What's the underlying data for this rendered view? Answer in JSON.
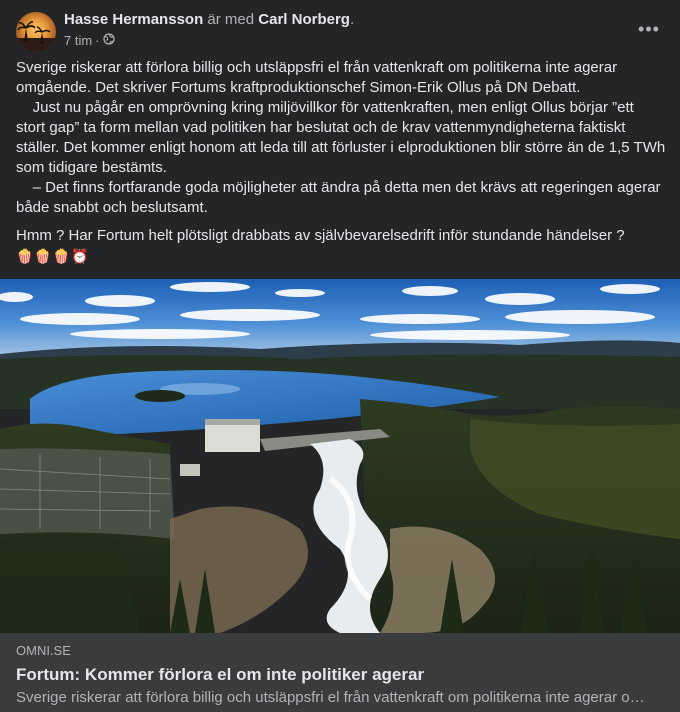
{
  "header": {
    "author": "Hasse Hermansson",
    "with_text": "är med",
    "tagged": "Carl Norberg",
    "period": ".",
    "time": "7 tim",
    "separator": "·",
    "privacy_icon": "globe-icon",
    "more_icon": "more-icon",
    "more_label": "•••"
  },
  "post": {
    "lines": [
      "Sverige riskerar att förlora billig och utsläppsfri el från vattenkraft om politikerna inte agerar",
      "omgående. Det skriver Fortums kraftproduktionschef Simon-Erik Ollus på DN Debatt.",
      "    Just nu pågår en omprövning kring miljövillkor för vattenkraften, men enligt Ollus börjar ”ett",
      "stort gap” ta form mellan vad politiken har beslutat och de krav vattenmyndigheterna faktiskt",
      "ställer. Det kommer enligt honom att leda till att förluster i elproduktionen blir större än de 1,5 TWh",
      "som tidigare bestämts.",
      "    – Det finns fortfarande goda möjligheter att ändra på detta men det krävs att regeringen agerar",
      "både snabbt och beslutsamt."
    ],
    "comment": "Hmm ? Har Fortum helt plötsligt drabbats av självbevarelsedrift inför stundande händelser ?",
    "emojis": "🍿🍿🍿⏰"
  },
  "link": {
    "domain": "OMNI.SE",
    "title": "Fortum: Kommer förlora el om inte politiker agerar",
    "description": "Sverige riskerar att förlora billig och utsläppsfri el från vattenkraft om politikerna inte agerar omgående. Det skriver Fortums kraftproduktionschef Simon-Erik Ollus på DN Debatt."
  }
}
